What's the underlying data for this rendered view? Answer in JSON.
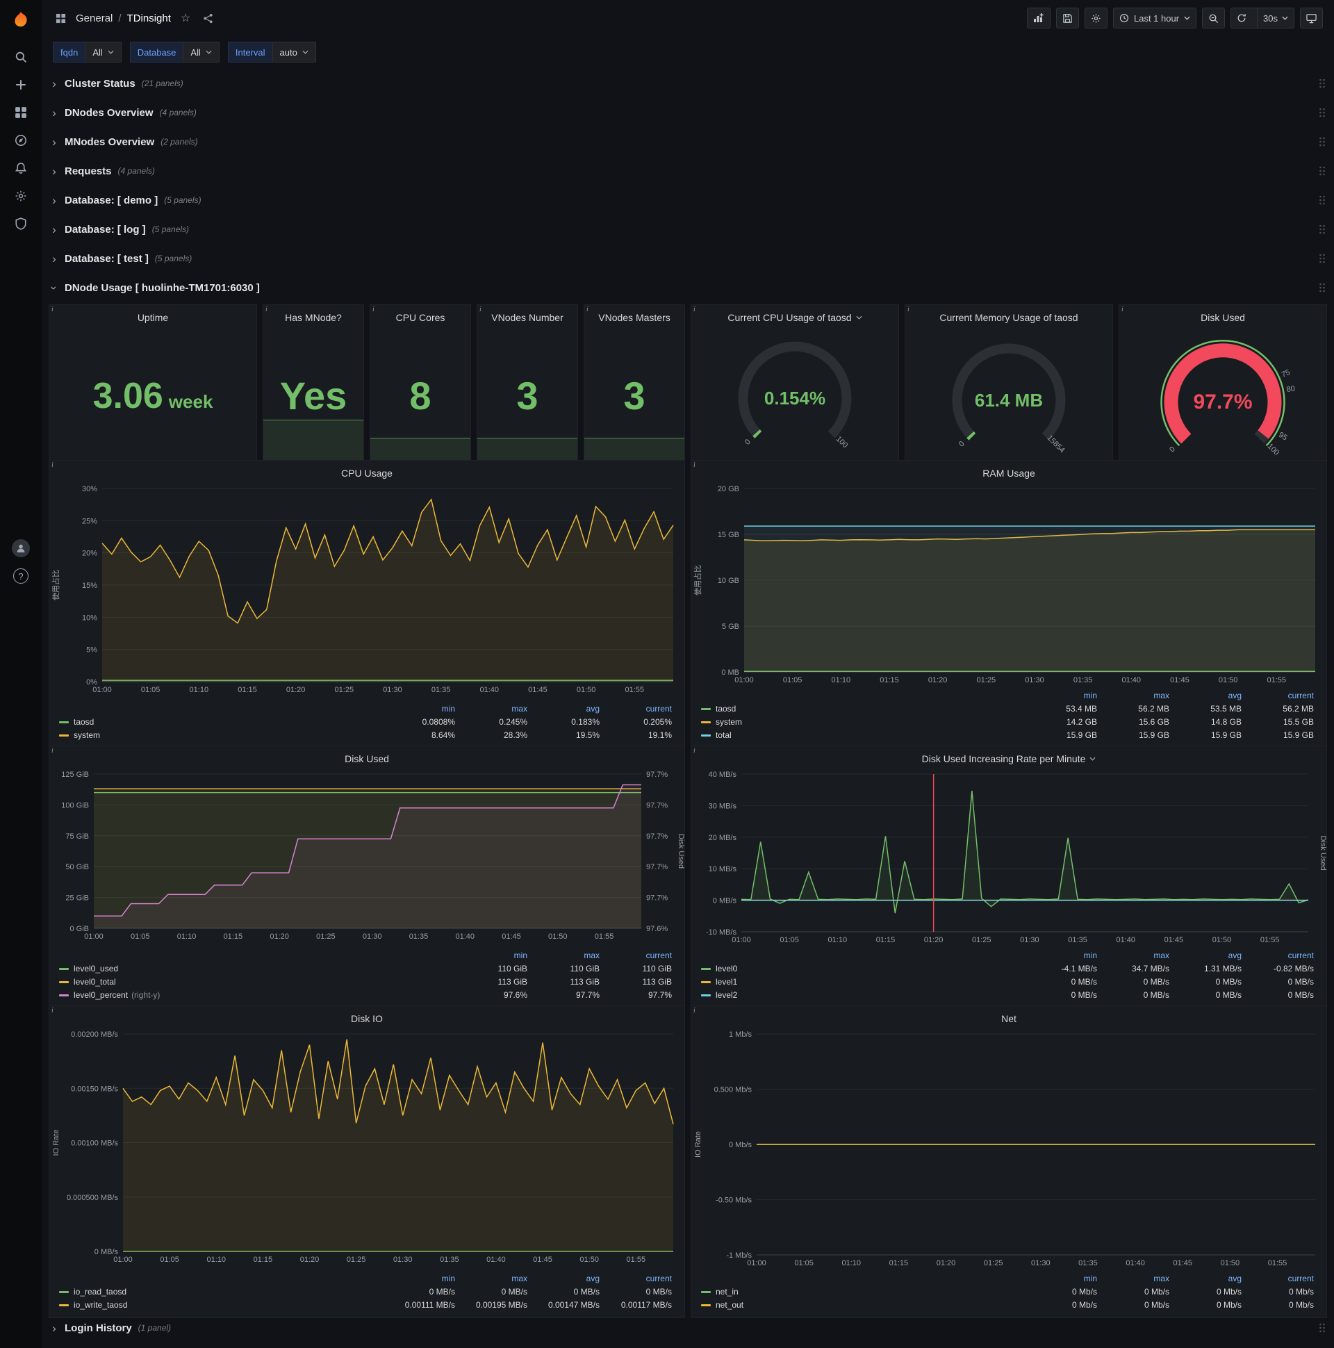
{
  "nav": {
    "breadcrumb": {
      "section": "General",
      "separator": "/",
      "title": "TDinsight"
    },
    "time_range": "Last 1 hour",
    "refresh": "30s"
  },
  "variables": [
    {
      "label": "fqdn",
      "value": "All"
    },
    {
      "label": "Database",
      "value": "All"
    },
    {
      "label": "Interval",
      "value": "auto"
    }
  ],
  "rows_top": [
    {
      "title": "Cluster Status",
      "count": "(21 panels)"
    },
    {
      "title": "DNodes Overview",
      "count": "(4 panels)"
    },
    {
      "title": "MNodes Overview",
      "count": "(2 panels)"
    },
    {
      "title": "Requests",
      "count": "(4 panels)"
    },
    {
      "title": "Database: [ demo ]",
      "count": "(5 panels)"
    },
    {
      "title": "Database: [ log ]",
      "count": "(5 panels)"
    },
    {
      "title": "Database: [ test ]",
      "count": "(5 panels)"
    }
  ],
  "expanded_row": {
    "title": "DNode Usage [ huolinhe-TM1701:6030 ]"
  },
  "rows_bottom": [
    {
      "title": "Login History",
      "count": "(1 panel)"
    }
  ],
  "stats": [
    {
      "title": "Uptime",
      "value": "3.06",
      "suffix": "week",
      "spark": 0
    },
    {
      "title": "Has MNode?",
      "value": "Yes",
      "spark": 0.33
    },
    {
      "title": "CPU Cores",
      "value": "8",
      "spark": 0.2
    },
    {
      "title": "VNodes Number",
      "value": "3",
      "spark": 0.2
    },
    {
      "title": "VNodes Masters",
      "value": "3",
      "spark": 0.2
    }
  ],
  "gauges": [
    {
      "title": "Current CPU Usage of taosd",
      "value": "0.154%",
      "fraction": 0.00154,
      "color": "#73bf69",
      "thick": 14,
      "font": 26,
      "scale": [
        {
          "pos": 0,
          "label": "0"
        },
        {
          "pos": 1,
          "label": "100"
        }
      ]
    },
    {
      "title": "Current Memory Usage of taosd",
      "value": "61.4 MB",
      "fraction": 0.0039,
      "color": "#73bf69",
      "thick": 14,
      "font": 26,
      "scale": [
        {
          "pos": 0,
          "label": "0"
        },
        {
          "pos": 1,
          "label": "15854"
        }
      ]
    },
    {
      "title": "Disk Used",
      "value": "97.7%",
      "fraction": 0.977,
      "color": "#f2495c",
      "ring": "#73bf69",
      "thick": 20,
      "font": 30,
      "scale": [
        {
          "pos": 0,
          "label": "0"
        },
        {
          "pos": 0.75,
          "label": "75"
        },
        {
          "pos": 0.8,
          "label": "80"
        },
        {
          "pos": 0.95,
          "label": "95"
        },
        {
          "pos": 1,
          "label": "100"
        }
      ]
    }
  ],
  "chart_data": [
    {
      "type": "line",
      "title": "CPU Usage",
      "ylabel": "使用占比",
      "ylim": [
        0,
        30
      ],
      "ml": 76,
      "y_ticks": [
        {
          "v": 0,
          "label": "0%"
        },
        {
          "v": 5,
          "label": "5%"
        },
        {
          "v": 10,
          "label": "10%"
        },
        {
          "v": 15,
          "label": "15%"
        },
        {
          "v": 20,
          "label": "20%"
        },
        {
          "v": 25,
          "label": "25%"
        },
        {
          "v": 30,
          "label": "30%"
        }
      ],
      "x_ticks": [
        "01:00",
        "01:05",
        "01:10",
        "01:15",
        "01:20",
        "01:25",
        "01:30",
        "01:35",
        "01:40",
        "01:45",
        "01:50",
        "01:55"
      ],
      "series": [
        {
          "name": "taosd",
          "color": "#73bf69",
          "fill": 0.1,
          "values": 0.2
        },
        {
          "name": "system",
          "color": "#eab839",
          "fill": 0.1,
          "values": [
            21.5,
            19.8,
            22.3,
            20.1,
            18.6,
            19.4,
            21.2,
            18.9,
            16.2,
            19.5,
            21.8,
            20.4,
            16.5,
            10.2,
            9.1,
            12.4,
            9.8,
            11.2,
            18.7,
            23.9,
            20.6,
            24.5,
            19.2,
            22.8,
            17.9,
            20.4,
            24.2,
            19.8,
            22.5,
            18.9,
            20.8,
            23.4,
            21.1,
            26.3,
            28.3,
            21.9,
            19.6,
            21.4,
            18.8,
            24.2,
            27.1,
            21.6,
            25.3,
            19.9,
            17.8,
            21.2,
            23.6,
            18.9,
            22.4,
            25.8,
            20.9,
            27.2,
            25.6,
            21.8,
            25.1,
            20.6,
            23.8,
            26.4,
            22.1,
            24.3
          ]
        }
      ],
      "legend": {
        "columns": [
          "min",
          "max",
          "avg",
          "current"
        ],
        "rows": [
          {
            "name": "taosd",
            "values": [
              "0.0808%",
              "0.245%",
              "0.183%",
              "0.205%"
            ]
          },
          {
            "name": "system",
            "values": [
              "8.64%",
              "28.3%",
              "19.5%",
              "19.1%"
            ]
          }
        ]
      }
    },
    {
      "type": "line",
      "title": "RAM Usage",
      "ylabel": "使用占比",
      "ylim": [
        0,
        20
      ],
      "ml": 76,
      "y_ticks": [
        {
          "v": 0,
          "label": "0 MB"
        },
        {
          "v": 5,
          "label": "5 GB"
        },
        {
          "v": 10,
          "label": "10 GB"
        },
        {
          "v": 15,
          "label": "15 GB"
        },
        {
          "v": 20,
          "label": "20 GB"
        }
      ],
      "x_ticks": [
        "01:00",
        "01:05",
        "01:10",
        "01:15",
        "01:20",
        "01:25",
        "01:30",
        "01:35",
        "01:40",
        "01:45",
        "01:50",
        "01:55"
      ],
      "series": [
        {
          "name": "taosd",
          "color": "#73bf69",
          "fill": 0.1,
          "values": 0.053
        },
        {
          "name": "system",
          "color": "#eab839",
          "fill": 0.1,
          "values": [
            14.4,
            14.35,
            14.3,
            14.32,
            14.35,
            14.33,
            14.3,
            14.35,
            14.4,
            14.38,
            14.35,
            14.4,
            14.42,
            14.4,
            14.38,
            14.4,
            14.45,
            14.42,
            14.4,
            14.45,
            14.5,
            14.48,
            14.45,
            14.5,
            14.52,
            14.5,
            14.55,
            14.6,
            14.65,
            14.7,
            14.75,
            14.8,
            14.85,
            14.9,
            14.95,
            15.0,
            15.05,
            15.1,
            15.1,
            15.15,
            15.2,
            15.2,
            15.25,
            15.3,
            15.3,
            15.35,
            15.35,
            15.4,
            15.4,
            15.45,
            15.45,
            15.5,
            15.5,
            15.5,
            15.5,
            15.5,
            15.5,
            15.5,
            15.5,
            15.5
          ]
        },
        {
          "name": "total",
          "color": "#6ed0e0",
          "fill": 0.08,
          "values": 15.9
        }
      ],
      "legend": {
        "columns": [
          "min",
          "max",
          "avg",
          "current"
        ],
        "rows": [
          {
            "name": "taosd",
            "values": [
              "53.4 MB",
              "56.2 MB",
              "53.5 MB",
              "56.2 MB"
            ]
          },
          {
            "name": "system",
            "values": [
              "14.2 GB",
              "15.6 GB",
              "14.8 GB",
              "15.5 GB"
            ]
          },
          {
            "name": "total",
            "values": [
              "15.9 GB",
              "15.9 GB",
              "15.9 GB",
              "15.9 GB"
            ]
          }
        ]
      }
    },
    {
      "type": "line",
      "title": "Disk Used",
      "ylim": [
        0,
        125
      ],
      "ml": 64,
      "mr": 62,
      "right_label": "Disk Used",
      "rlim": [
        97.64,
        97.74
      ],
      "y_ticks": [
        {
          "v": 0,
          "label": "0 GiB"
        },
        {
          "v": 25,
          "label": "25 GiB"
        },
        {
          "v": 50,
          "label": "50 GiB"
        },
        {
          "v": 75,
          "label": "75 GiB"
        },
        {
          "v": 100,
          "label": "100 GiB"
        },
        {
          "v": 125,
          "label": "125 GiB"
        }
      ],
      "right_ticks": [
        {
          "v": 97.64,
          "label": "97.6%"
        },
        {
          "v": 97.66,
          "label": "97.7%"
        },
        {
          "v": 97.68,
          "label": "97.7%"
        },
        {
          "v": 97.7,
          "label": "97.7%"
        },
        {
          "v": 97.72,
          "label": "97.7%"
        },
        {
          "v": 97.74,
          "label": "97.7%"
        }
      ],
      "x_ticks": [
        "01:00",
        "01:05",
        "01:10",
        "01:15",
        "01:20",
        "01:25",
        "01:30",
        "01:35",
        "01:40",
        "01:45",
        "01:50",
        "01:55"
      ],
      "series": [
        {
          "name": "level0_used",
          "color": "#73bf69",
          "fill": 0.08,
          "values": 110
        },
        {
          "name": "level0_total",
          "color": "#eab839",
          "fill": 0.06,
          "values": 113
        },
        {
          "name": "level0_percent",
          "color": "#d683ce",
          "fill": 0.08,
          "axis": "right",
          "values": [
            97.648,
            97.648,
            97.648,
            97.648,
            97.656,
            97.656,
            97.656,
            97.656,
            97.662,
            97.662,
            97.662,
            97.662,
            97.662,
            97.668,
            97.668,
            97.668,
            97.668,
            97.676,
            97.676,
            97.676,
            97.676,
            97.676,
            97.698,
            97.698,
            97.698,
            97.698,
            97.698,
            97.698,
            97.698,
            97.698,
            97.698,
            97.698,
            97.698,
            97.718,
            97.718,
            97.718,
            97.718,
            97.718,
            97.718,
            97.718,
            97.718,
            97.718,
            97.718,
            97.718,
            97.718,
            97.718,
            97.718,
            97.718,
            97.718,
            97.718,
            97.718,
            97.718,
            97.718,
            97.718,
            97.718,
            97.718,
            97.718,
            97.733,
            97.733,
            97.733
          ]
        }
      ],
      "legend": {
        "columns": [
          "min",
          "max",
          "current"
        ],
        "rows": [
          {
            "name": "level0_used",
            "values": [
              "110 GiB",
              "110 GiB",
              "110 GiB"
            ]
          },
          {
            "name": "level0_total",
            "values": [
              "113 GiB",
              "113 GiB",
              "113 GiB"
            ]
          },
          {
            "name": "level0_percent",
            "note": "(right-y)",
            "values": [
              "97.6%",
              "97.7%",
              "97.7%"
            ]
          }
        ]
      }
    },
    {
      "type": "line",
      "title": "Disk Used Increasing Rate per Minute",
      "ylim": [
        -10,
        40
      ],
      "ml": 72,
      "mr": 26,
      "right_label": "Disk Used",
      "annotation_frac": 0.339,
      "y_ticks": [
        {
          "v": -10,
          "label": "-10 MB/s"
        },
        {
          "v": 0,
          "label": "0 MB/s"
        },
        {
          "v": 10,
          "label": "10 MB/s"
        },
        {
          "v": 20,
          "label": "20 MB/s"
        },
        {
          "v": 30,
          "label": "30 MB/s"
        },
        {
          "v": 40,
          "label": "40 MB/s"
        }
      ],
      "x_ticks": [
        "01:00",
        "01:05",
        "01:10",
        "01:15",
        "01:20",
        "01:25",
        "01:30",
        "01:35",
        "01:40",
        "01:45",
        "01:50",
        "01:55"
      ],
      "series": [
        {
          "name": "level0",
          "color": "#73bf69",
          "fill": 0.1,
          "values": [
            0.3,
            0.2,
            18.5,
            0.4,
            -1.0,
            0.3,
            0.2,
            8.9,
            0.3,
            0.2,
            0.4,
            0.3,
            0.2,
            0.4,
            0.3,
            20.3,
            -4.1,
            12.4,
            0.3,
            0.2,
            0.4,
            0.3,
            0.2,
            0.4,
            34.7,
            0.6,
            -2.0,
            0.4,
            0.3,
            0.2,
            0.4,
            0.3,
            0.2,
            0.4,
            19.8,
            0.3,
            0.2,
            0.4,
            0.3,
            0.2,
            0.3,
            0.4,
            0.2,
            0.3,
            0.4,
            0.2,
            0.3,
            0.2,
            0.4,
            0.3,
            0.2,
            0.3,
            0.2,
            0.4,
            0.3,
            0.2,
            0.3,
            5.2,
            -0.82,
            0.1
          ]
        },
        {
          "name": "level1",
          "color": "#eab839",
          "fill": 0,
          "values": 0
        },
        {
          "name": "level2",
          "color": "#6ed0e0",
          "fill": 0,
          "values": 0
        }
      ],
      "legend": {
        "columns": [
          "min",
          "max",
          "avg",
          "current"
        ],
        "rows": [
          {
            "name": "level0",
            "values": [
              "-4.1 MB/s",
              "34.7 MB/s",
              "1.31 MB/s",
              "-0.82 MB/s"
            ]
          },
          {
            "name": "level1",
            "values": [
              "0 MB/s",
              "0 MB/s",
              "0 MB/s",
              "0 MB/s"
            ]
          },
          {
            "name": "level2",
            "values": [
              "0 MB/s",
              "0 MB/s",
              "0 MB/s",
              "0 MB/s"
            ]
          }
        ]
      }
    },
    {
      "type": "line",
      "title": "Disk IO",
      "ylabel": "IO Rate",
      "ylim": [
        0,
        0.002
      ],
      "ml": 106,
      "y_ticks": [
        {
          "v": 0,
          "label": "0 MB/s"
        },
        {
          "v": 0.0005,
          "label": "0.000500 MB/s"
        },
        {
          "v": 0.001,
          "label": "0.00100 MB/s"
        },
        {
          "v": 0.0015,
          "label": "0.00150 MB/s"
        },
        {
          "v": 0.002,
          "label": "0.00200 MB/s"
        }
      ],
      "x_ticks": [
        "01:00",
        "01:05",
        "01:10",
        "01:15",
        "01:20",
        "01:25",
        "01:30",
        "01:35",
        "01:40",
        "01:45",
        "01:50",
        "01:55"
      ],
      "series": [
        {
          "name": "io_read_taosd",
          "color": "#73bf69",
          "fill": 0.1,
          "values": 0
        },
        {
          "name": "io_write_taosd",
          "color": "#eab839",
          "fill": 0.1,
          "values": [
            0.0015,
            0.00138,
            0.00142,
            0.00135,
            0.00148,
            0.00152,
            0.0014,
            0.00155,
            0.00148,
            0.00138,
            0.0016,
            0.00135,
            0.0018,
            0.00125,
            0.00158,
            0.00148,
            0.00132,
            0.00185,
            0.00128,
            0.00165,
            0.0019,
            0.00122,
            0.00175,
            0.0014,
            0.00195,
            0.00118,
            0.00152,
            0.00168,
            0.00135,
            0.00172,
            0.00125,
            0.00158,
            0.00145,
            0.00178,
            0.0013,
            0.00162,
            0.00148,
            0.00135,
            0.0017,
            0.00142,
            0.00155,
            0.00128,
            0.00165,
            0.0015,
            0.00138,
            0.00192,
            0.0013,
            0.0016,
            0.00145,
            0.00135,
            0.00168,
            0.00152,
            0.0014,
            0.00158,
            0.00132,
            0.00148,
            0.00155,
            0.00136,
            0.0015,
            0.00117
          ]
        }
      ],
      "legend": {
        "columns": [
          "min",
          "max",
          "avg",
          "current"
        ],
        "rows": [
          {
            "name": "io_read_taosd",
            "values": [
              "0 MB/s",
              "0 MB/s",
              "0 MB/s",
              "0 MB/s"
            ]
          },
          {
            "name": "io_write_taosd",
            "values": [
              "0.00111 MB/s",
              "0.00195 MB/s",
              "0.00147 MB/s",
              "0.00117 MB/s"
            ]
          }
        ]
      }
    },
    {
      "type": "line",
      "title": "Net",
      "ylabel": "IO Rate",
      "ylim": [
        -1,
        1
      ],
      "ml": 94,
      "y_ticks": [
        {
          "v": -1,
          "label": "-1 Mb/s"
        },
        {
          "v": -0.5,
          "label": "-0.50 Mb/s"
        },
        {
          "v": 0,
          "label": "0 Mb/s"
        },
        {
          "v": 0.5,
          "label": "0.500 Mb/s"
        },
        {
          "v": 1,
          "label": "1 Mb/s"
        }
      ],
      "x_ticks": [
        "01:00",
        "01:05",
        "01:10",
        "01:15",
        "01:20",
        "01:25",
        "01:30",
        "01:35",
        "01:40",
        "01:45",
        "01:50",
        "01:55"
      ],
      "series": [
        {
          "name": "net_in",
          "color": "#73bf69",
          "fill": 0,
          "values": 0
        },
        {
          "name": "net_out",
          "color": "#eab839",
          "fill": 0,
          "values": 0
        }
      ],
      "legend": {
        "columns": [
          "min",
          "max",
          "avg",
          "current"
        ],
        "rows": [
          {
            "name": "net_in",
            "values": [
              "0 Mb/s",
              "0 Mb/s",
              "0 Mb/s",
              "0 Mb/s"
            ]
          },
          {
            "name": "net_out",
            "values": [
              "0 Mb/s",
              "0 Mb/s",
              "0 Mb/s",
              "0 Mb/s"
            ]
          }
        ]
      }
    }
  ]
}
